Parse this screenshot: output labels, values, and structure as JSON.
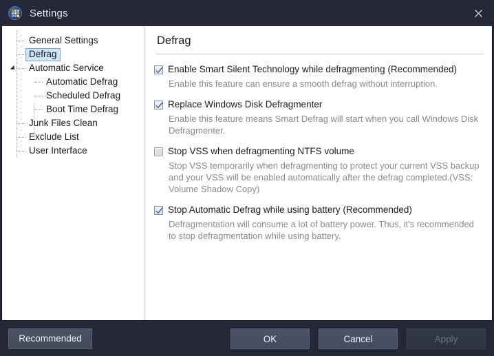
{
  "window": {
    "title": "Settings",
    "app_icon": "app-logo-icon",
    "close_icon": "close-icon"
  },
  "sidebar": {
    "items": [
      {
        "label": "General Settings",
        "level": 0,
        "selected": false,
        "expander": false
      },
      {
        "label": "Defrag",
        "level": 0,
        "selected": true,
        "expander": false
      },
      {
        "label": "Automatic Service",
        "level": 0,
        "selected": false,
        "expander": true
      },
      {
        "label": "Automatic Defrag",
        "level": 1,
        "selected": false,
        "expander": false
      },
      {
        "label": "Scheduled Defrag",
        "level": 1,
        "selected": false,
        "expander": false
      },
      {
        "label": "Boot Time Defrag",
        "level": 1,
        "selected": false,
        "expander": false
      },
      {
        "label": "Junk Files Clean",
        "level": 0,
        "selected": false,
        "expander": false
      },
      {
        "label": "Exclude List",
        "level": 0,
        "selected": false,
        "expander": false
      },
      {
        "label": "User Interface",
        "level": 0,
        "selected": false,
        "expander": false
      }
    ]
  },
  "content": {
    "page_title": "Defrag",
    "options": [
      {
        "title": "Enable Smart Silent Technology while defragmenting (Recommended)",
        "description": "Enable this feature can ensure a smooth defrag without interruption.",
        "checked": true
      },
      {
        "title": "Replace Windows Disk Defragmenter",
        "description": "Enable this feature means Smart Defrag will start when you call Windows Disk Defragmenter.",
        "checked": true
      },
      {
        "title": "Stop VSS when defragmenting NTFS volume",
        "description": "Stop VSS temporarily when defragmenting to protect your current VSS backup and your VSS will be enabled automatically after the defrag completed.(VSS: Volume Shadow Copy)",
        "checked": false
      },
      {
        "title": "Stop Automatic Defrag while using battery (Recommended)",
        "description": "Defragmentation will consume a lot of battery power. Thus, it’s recommended to stop defragmentation while using battery.",
        "checked": true
      }
    ]
  },
  "footer": {
    "recommended_label": "Recommended",
    "ok_label": "OK",
    "cancel_label": "Cancel",
    "apply_label": "Apply",
    "apply_disabled": true
  },
  "colors": {
    "chrome": "#242839",
    "content_bg": "#ffffff",
    "selection": "#cce4f7",
    "selection_border": "#7aa9d4",
    "check_blue": "#2b5fa8",
    "muted_text": "#8a8a8a",
    "button_face": "#4e5467",
    "button_disabled_text": "#6a7087"
  }
}
